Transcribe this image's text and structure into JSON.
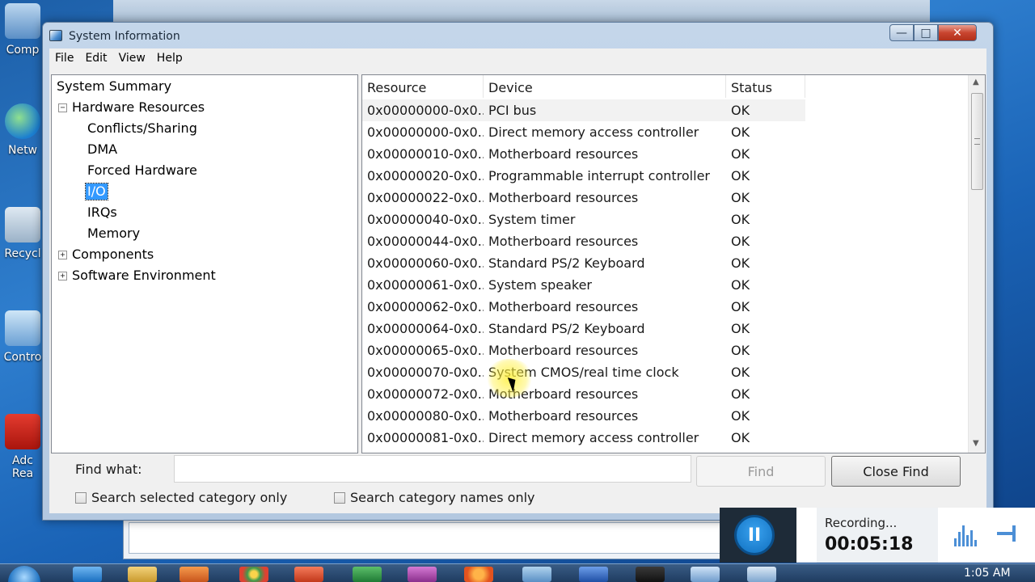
{
  "desktop": {
    "icons": [
      {
        "label": "Comp",
        "icon": "computer-icon"
      },
      {
        "label": "Netw",
        "icon": "network-icon"
      },
      {
        "label": "Recycl",
        "icon": "recycle-bin-icon"
      },
      {
        "label": "Contro",
        "icon": "control-panel-icon"
      },
      {
        "label": "Adc",
        "icon": "adobe-reader-icon"
      },
      {
        "label": "Rea",
        "icon": "adobe-reader-icon"
      }
    ]
  },
  "window": {
    "title": "System Information",
    "minimize_glyph": "—",
    "maximize_glyph": "□",
    "close_glyph": "✕"
  },
  "menu": [
    "File",
    "Edit",
    "View",
    "Help"
  ],
  "tree": {
    "root": "System Summary",
    "hardware": "Hardware Resources",
    "hardware_children": [
      "Conflicts/Sharing",
      "DMA",
      "Forced Hardware",
      "I/O",
      "IRQs",
      "Memory"
    ],
    "selected": "I/O",
    "components": "Components",
    "software": "Software Environment",
    "collapse_glyph": "−",
    "expand_glyph": "+"
  },
  "list": {
    "columns": [
      "Resource",
      "Device",
      "Status"
    ],
    "rows": [
      {
        "resource": "0x00000000-0x0...",
        "device": "PCI bus",
        "status": "OK"
      },
      {
        "resource": "0x00000000-0x0...",
        "device": "Direct memory access controller",
        "status": "OK"
      },
      {
        "resource": "0x00000010-0x0...",
        "device": "Motherboard resources",
        "status": "OK"
      },
      {
        "resource": "0x00000020-0x0...",
        "device": "Programmable interrupt controller",
        "status": "OK"
      },
      {
        "resource": "0x00000022-0x0...",
        "device": "Motherboard resources",
        "status": "OK"
      },
      {
        "resource": "0x00000040-0x0...",
        "device": "System timer",
        "status": "OK"
      },
      {
        "resource": "0x00000044-0x0...",
        "device": "Motherboard resources",
        "status": "OK"
      },
      {
        "resource": "0x00000060-0x0...",
        "device": "Standard PS/2 Keyboard",
        "status": "OK"
      },
      {
        "resource": "0x00000061-0x0...",
        "device": "System speaker",
        "status": "OK"
      },
      {
        "resource": "0x00000062-0x0...",
        "device": "Motherboard resources",
        "status": "OK"
      },
      {
        "resource": "0x00000064-0x0...",
        "device": "Standard PS/2 Keyboard",
        "status": "OK"
      },
      {
        "resource": "0x00000065-0x0...",
        "device": "Motherboard resources",
        "status": "OK"
      },
      {
        "resource": "0x00000070-0x0...",
        "device": "System CMOS/real time clock",
        "status": "OK"
      },
      {
        "resource": "0x00000072-0x0...",
        "device": "Motherboard resources",
        "status": "OK"
      },
      {
        "resource": "0x00000080-0x0...",
        "device": "Motherboard resources",
        "status": "OK"
      },
      {
        "resource": "0x00000081-0x0...",
        "device": "Direct memory access controller",
        "status": "OK"
      }
    ],
    "scroll_up_glyph": "▲",
    "scroll_down_glyph": "▼"
  },
  "find": {
    "label": "Find what:",
    "value": "",
    "find_button": "Find",
    "close_find_button": "Close Find",
    "search_selected": "Search selected category only",
    "search_names": "Search category names only"
  },
  "recorder": {
    "status": "Recording...",
    "time": "00:05:18",
    "pause_glyph": "II"
  },
  "taskbar": {
    "clock": "1:05 AM"
  },
  "colors": {
    "selection": "#3399ff",
    "desktop": "#2f7fcf",
    "recorder_accent": "#1a86e0"
  }
}
